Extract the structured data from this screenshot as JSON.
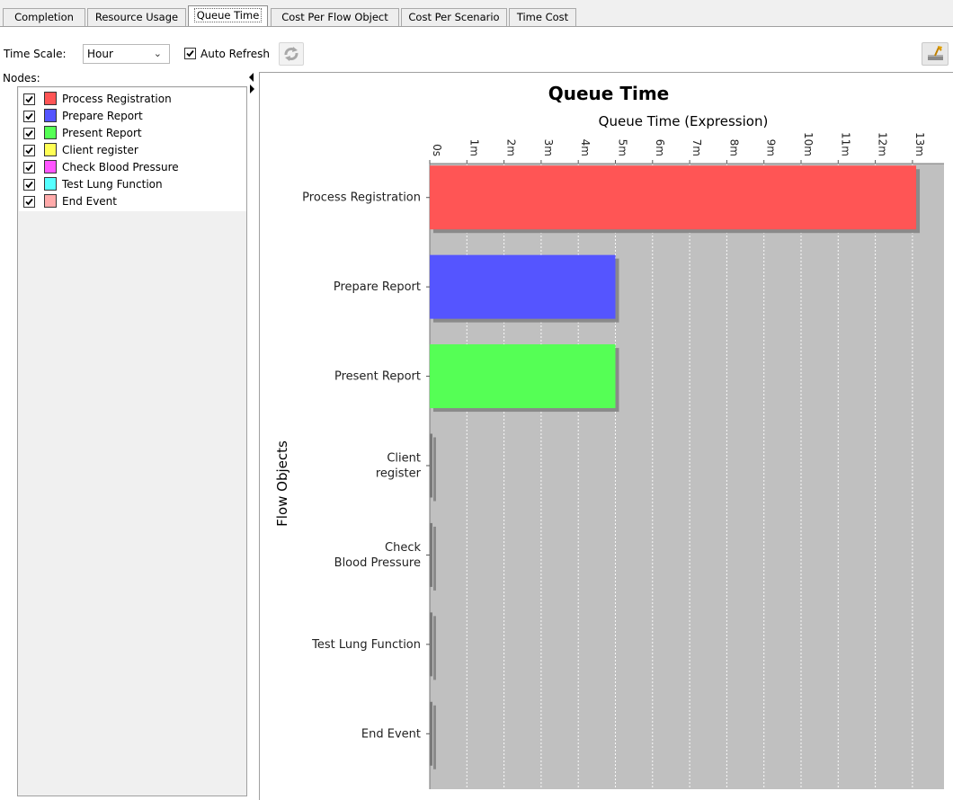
{
  "tabs": [
    {
      "label": "Completion",
      "active": false
    },
    {
      "label": "Resource Usage",
      "active": false
    },
    {
      "label": "Queue Time",
      "active": true
    },
    {
      "label": "Cost Per Flow Object",
      "active": false
    },
    {
      "label": "Cost Per Scenario",
      "active": false
    },
    {
      "label": "Time Cost",
      "active": false
    }
  ],
  "toolbar": {
    "time_scale_label": "Time Scale:",
    "time_scale_value": "Hour",
    "auto_refresh_label": "Auto Refresh",
    "auto_refresh_checked": true,
    "refresh_icon": "refresh-icon",
    "export_icon": "export-icon"
  },
  "nodes": {
    "title": "Nodes:",
    "items": [
      {
        "label": "Process Registration",
        "color": "#ff5555",
        "checked": true
      },
      {
        "label": "Prepare Report",
        "color": "#5555ff",
        "checked": true
      },
      {
        "label": "Present Report",
        "color": "#55ff55",
        "checked": true
      },
      {
        "label": "Client register",
        "color": "#ffff55",
        "checked": true
      },
      {
        "label": "Check Blood Pressure",
        "color": "#ff55ff",
        "checked": true
      },
      {
        "label": "Test Lung Function",
        "color": "#55ffff",
        "checked": true
      },
      {
        "label": "End Event",
        "color": "#ffaaaa",
        "checked": true
      }
    ]
  },
  "chart_data": {
    "type": "bar",
    "orientation": "horizontal",
    "title": "Queue Time",
    "xlabel": "Queue Time (Expression)",
    "ylabel": "Flow Objects",
    "xlim": [
      0,
      13.2
    ],
    "x_unit": "minutes",
    "xticks": [
      "0s",
      "1m",
      "2m",
      "3m",
      "4m",
      "5m",
      "6m",
      "7m",
      "8m",
      "9m",
      "10m",
      "11m",
      "12m",
      "13m"
    ],
    "categories": [
      {
        "lines": [
          "Process Registration"
        ]
      },
      {
        "lines": [
          "Prepare Report"
        ]
      },
      {
        "lines": [
          "Present Report"
        ]
      },
      {
        "lines": [
          "Client",
          "register"
        ]
      },
      {
        "lines": [
          "Check",
          "Blood Pressure"
        ]
      },
      {
        "lines": [
          "Test Lung Function"
        ]
      },
      {
        "lines": [
          "End Event"
        ]
      }
    ],
    "values": [
      13.1,
      5.0,
      5.0,
      0.02,
      0.02,
      0.02,
      0.02
    ],
    "colors": [
      "#ff5555",
      "#5555ff",
      "#55ff55",
      "#ffff55",
      "#ff55ff",
      "#55ffff",
      "#ffaaaa"
    ],
    "grid": true,
    "plot_background": "#c0c0c0"
  }
}
